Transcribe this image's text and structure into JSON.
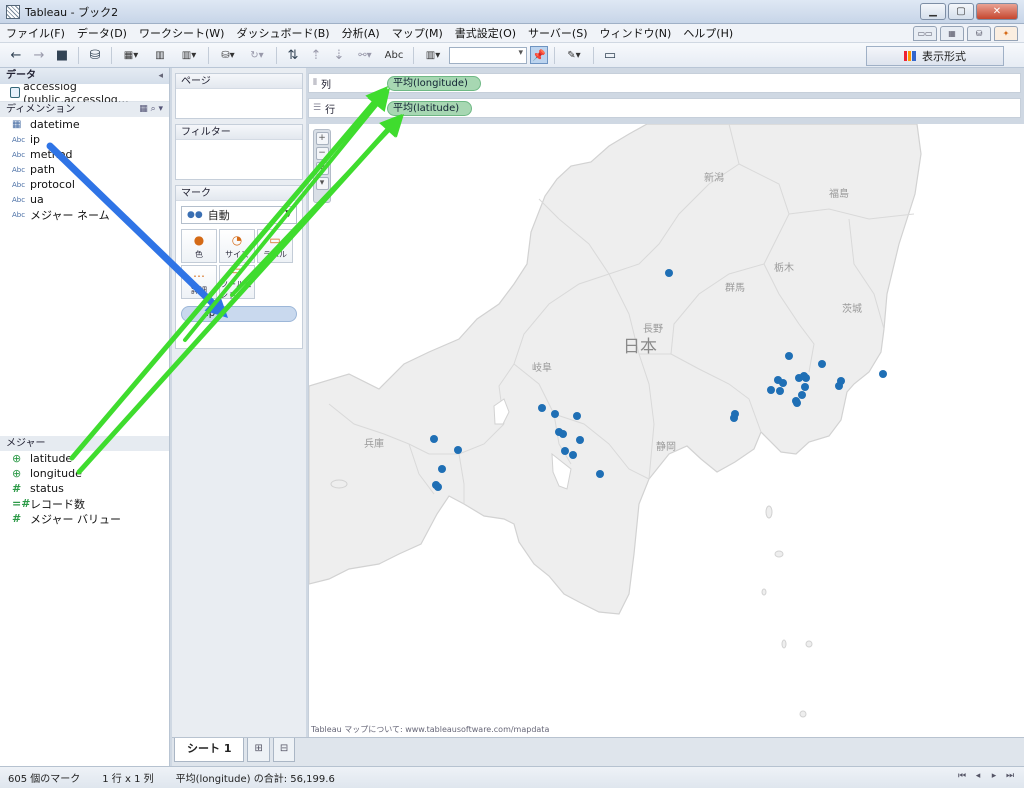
{
  "window": {
    "title": "Tableau - ブック2"
  },
  "menu": [
    "ファイル(F)",
    "データ(D)",
    "ワークシート(W)",
    "ダッシュボード(B)",
    "分析(A)",
    "マップ(M)",
    "書式設定(O)",
    "サーバー(S)",
    "ウィンドウ(N)",
    "ヘルプ(H)"
  ],
  "toolbar": {
    "abc_label": "Abc",
    "show_me_label": "表示形式"
  },
  "data_pane": {
    "header": "データ",
    "datasource": "accesslog (public.accesslog…",
    "dimensions_header": "ディメンション",
    "dimensions": [
      {
        "icon": "calendar",
        "badge": "",
        "name": "datetime"
      },
      {
        "icon": "abc",
        "badge": "Abc",
        "name": "ip"
      },
      {
        "icon": "abc",
        "badge": "Abc",
        "name": "method"
      },
      {
        "icon": "abc",
        "badge": "Abc",
        "name": "path"
      },
      {
        "icon": "abc",
        "badge": "Abc",
        "name": "protocol"
      },
      {
        "icon": "abc",
        "badge": "Abc",
        "name": "ua"
      },
      {
        "icon": "abc",
        "badge": "Abc",
        "name": "メジャー ネーム"
      }
    ],
    "measures_header": "メジャー",
    "measures": [
      {
        "icon": "globe",
        "badge": "⊕",
        "name": "latitude"
      },
      {
        "icon": "globe",
        "badge": "⊕",
        "name": "longitude"
      },
      {
        "icon": "hash",
        "badge": "#",
        "name": "status"
      },
      {
        "icon": "hash",
        "badge": "=#",
        "name": "レコード数"
      },
      {
        "icon": "hash",
        "badge": "#",
        "name": "メジャー バリュー"
      }
    ]
  },
  "cards": {
    "pages_title": "ページ",
    "filters_title": "フィルター",
    "marks_title": "マーク",
    "mark_type": "自動",
    "mark_buttons": [
      {
        "label": "色",
        "icon": "color-icon"
      },
      {
        "label": "サイズ",
        "icon": "size-icon"
      },
      {
        "label": "ラベル",
        "icon": "label-icon"
      },
      {
        "label": "詳細",
        "icon": "detail-icon"
      },
      {
        "label": "ツールヒント",
        "icon": "tooltip-icon"
      }
    ],
    "mark_pill": "ip"
  },
  "shelves": {
    "columns_label": "列",
    "columns_pill": "平均(longitude)",
    "rows_label": "行",
    "rows_pill": "平均(latitude)"
  },
  "map": {
    "prefectures": [
      "新潟",
      "福島",
      "栃木",
      "群馬",
      "茨城",
      "長野",
      "岐阜",
      "兵庫",
      "静岡"
    ],
    "country_label": "日本",
    "attribution": "Tableau マップについて: www.tableausoftware.com/mapdata",
    "dot_color": "#1f6fb5"
  },
  "sheets": {
    "active": "シート 1"
  },
  "status": {
    "marks": "605 個のマーク",
    "grid": "1 行 x 1 列",
    "sum": "平均(longitude) の合計: 56,199.6"
  },
  "annotations": {
    "blue_arrow_color": "#2f74e6",
    "green_arrow_color": "#3fdc2e"
  }
}
